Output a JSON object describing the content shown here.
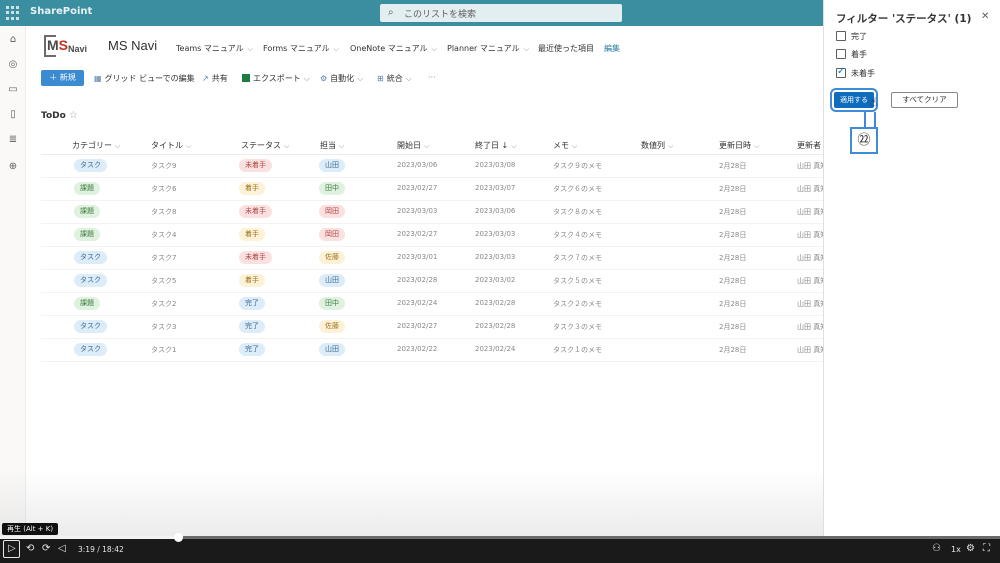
{
  "topbar": {
    "brand": "SharePoint",
    "search_placeholder": "このリストを検索"
  },
  "site": {
    "logo_ms": "M",
    "logo_s": "S",
    "logo_navi": "Navi",
    "title": "MS Navi",
    "nav": [
      "Teams マニュアル",
      "Forms マニュアル",
      "OneNote マニュアル",
      "Planner マニュアル",
      "最近使った項目",
      "編集"
    ]
  },
  "commands": {
    "new": "新規",
    "grid_edit": "グリッド ビューでの編集",
    "share": "共有",
    "export": "エクスポート",
    "automate": "自動化",
    "integrate": "統合",
    "more": "···"
  },
  "list": {
    "title": "ToDo",
    "columns": [
      "カテゴリー",
      "タイトル",
      "ステータス",
      "担当",
      "開始日",
      "終了日 ↓",
      "メモ",
      "数値列",
      "更新日時",
      "更新者"
    ],
    "rows": [
      {
        "category": "タスク",
        "title": "タスク9",
        "status": "未着手",
        "owner": "山田",
        "start": "2023/03/06",
        "end": "2023/03/08",
        "memo": "タスク９のメモ",
        "num": "",
        "modified": "2月28日",
        "editor": "山田 真知"
      },
      {
        "category": "課題",
        "title": "タスク6",
        "status": "着手",
        "owner": "田中",
        "start": "2023/02/27",
        "end": "2023/03/07",
        "memo": "タスク６のメモ",
        "num": "",
        "modified": "2月28日",
        "editor": "山田 真知"
      },
      {
        "category": "課題",
        "title": "タスク8",
        "status": "未着手",
        "owner": "岡田",
        "start": "2023/03/03",
        "end": "2023/03/06",
        "memo": "タスク８のメモ",
        "num": "",
        "modified": "2月28日",
        "editor": "山田 真知"
      },
      {
        "category": "課題",
        "title": "タスク4",
        "status": "着手",
        "owner": "岡田",
        "start": "2023/02/27",
        "end": "2023/03/03",
        "memo": "タスク４のメモ",
        "num": "",
        "modified": "2月28日",
        "editor": "山田 真知"
      },
      {
        "category": "タスク",
        "title": "タスク7",
        "status": "未着手",
        "owner": "佐藤",
        "start": "2023/03/01",
        "end": "2023/03/03",
        "memo": "タスク７のメモ",
        "num": "",
        "modified": "2月28日",
        "editor": "山田 真知"
      },
      {
        "category": "タスク",
        "title": "タスク5",
        "status": "着手",
        "owner": "山田",
        "start": "2023/02/28",
        "end": "2023/03/02",
        "memo": "タスク５のメモ",
        "num": "",
        "modified": "2月28日",
        "editor": "山田 真知"
      },
      {
        "category": "課題",
        "title": "タスク2",
        "status": "完了",
        "owner": "田中",
        "start": "2023/02/24",
        "end": "2023/02/28",
        "memo": "タスク２のメモ",
        "num": "",
        "modified": "2月28日",
        "editor": "山田 真知"
      },
      {
        "category": "タスク",
        "title": "タスク3",
        "status": "完了",
        "owner": "佐藤",
        "start": "2023/02/27",
        "end": "2023/02/28",
        "memo": "タスク３のメモ",
        "num": "",
        "modified": "2月28日",
        "editor": "山田 真知"
      },
      {
        "category": "タスク",
        "title": "タスク1",
        "status": "完了",
        "owner": "山田",
        "start": "2023/02/22",
        "end": "2023/02/24",
        "memo": "タスク１のメモ",
        "num": "",
        "modified": "2月28日",
        "editor": "山田 真知"
      }
    ]
  },
  "filter_panel": {
    "title": "フィルター 'ステータス' (1)",
    "close": "✕",
    "options": [
      {
        "label": "完了",
        "checked": false
      },
      {
        "label": "着手",
        "checked": false
      },
      {
        "label": "未着手",
        "checked": true
      }
    ],
    "apply": "適用する",
    "clear": "すべてクリア",
    "step_marker": "㉒"
  },
  "player": {
    "tooltip": "再生 (Alt + K)",
    "time": "3:19 / 18:42",
    "speed": "1x",
    "progress_fraction": 0.178
  },
  "colors": {
    "topbar": "#3b8da0",
    "accent": "#0f6cbd",
    "pill": {
      "タスク": {
        "bg": "#dcecf8",
        "fg": "#3a6a96"
      },
      "課題": {
        "bg": "#dff2df",
        "fg": "#3f7a3f"
      },
      "未着手": {
        "bg": "#fbe0e0",
        "fg": "#b24848"
      },
      "着手": {
        "bg": "#fdf1d6",
        "fg": "#9c7422"
      },
      "完了": {
        "bg": "#dcecf8",
        "fg": "#3a6a96"
      },
      "山田": {
        "bg": "#dcecf8",
        "fg": "#3a6a96"
      },
      "田中": {
        "bg": "#dff2df",
        "fg": "#3f7a3f"
      },
      "岡田": {
        "bg": "#fbe0e0",
        "fg": "#b24848"
      },
      "佐藤": {
        "bg": "#fdf1d6",
        "fg": "#9c7422"
      }
    }
  }
}
